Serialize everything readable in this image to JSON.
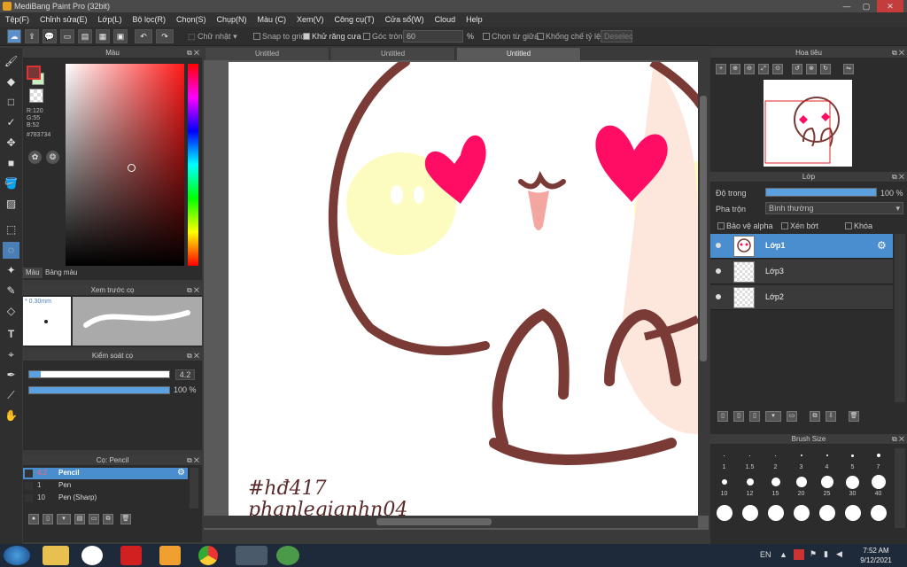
{
  "window": {
    "title": "MediBang Paint Pro (32bit)",
    "minimize": "—",
    "maximize": "▢",
    "close": "✕"
  },
  "menu": [
    "Tệp(F)",
    "Chỉnh sửa(E)",
    "Lớp(L)",
    "Bộ lọc(R)",
    "Chọn(S)",
    "Chụp(N)",
    "Màu (C)",
    "Xem(V)",
    "Công cụ(T)",
    "Cửa sổ(W)",
    "Cloud",
    "Help"
  ],
  "toolbar": {
    "selection_mode": "Chữ nhật",
    "snap_to_grid": "Snap to grid",
    "antialias": "Khử răng cưa",
    "round_corner": "Góc tròn",
    "round_value": "60",
    "percent": "%",
    "select_center": "Chọn từ giữa",
    "fixed_ratio": "Khống chế tỷ lệ",
    "deselect": "Deselec"
  },
  "color_panel": {
    "title": "Màu",
    "r": "R:120",
    "g": "G:55",
    "b": "B:52",
    "hex": "#783734",
    "tab_color": "Màu",
    "tab_palette": "Bảng màu",
    "primary": "#783734",
    "secondary": "#c8f0c0"
  },
  "brush_preview": {
    "title": "Xem trước cọ",
    "size": "0.30mm"
  },
  "brush_control": {
    "title": "Kiểm soát cọ",
    "size_value": "4.2",
    "opacity_value": "100 %",
    "size_fraction": 0.08,
    "opacity_fraction": 1.0
  },
  "brush_list": {
    "title": "Cọ: Pencil",
    "items": [
      {
        "size": "4.2",
        "name": "Pencil"
      },
      {
        "size": "1",
        "name": "Pen"
      },
      {
        "size": "10",
        "name": "Pen (Sharp)"
      }
    ]
  },
  "doc_tabs": [
    "Untitled",
    "Untitled",
    "Untitled"
  ],
  "canvas": {
    "signature_line1": "#hđ417",
    "signature_line2": "phanlegianhn04"
  },
  "navigator": {
    "title": "Hoa tiêu"
  },
  "layers_panel": {
    "title": "Lớp",
    "opacity_label": "Độ trong",
    "opacity_value": "100 %",
    "opacity_fraction": 1.0,
    "blend_label": "Pha trộn",
    "blend_value": "Bình thường",
    "protect_alpha": "Bảo vệ alpha",
    "clipping": "Xén bớt",
    "lock": "Khóa",
    "layers": [
      {
        "name": "Lớp1"
      },
      {
        "name": "Lớp3"
      },
      {
        "name": "Lớp2"
      }
    ]
  },
  "brush_size": {
    "title": "Brush Size",
    "row1": [
      "1",
      "1.5",
      "2",
      "3",
      "4",
      "5",
      "7"
    ],
    "row2": [
      "10",
      "12",
      "15",
      "20",
      "25",
      "30",
      "40"
    ]
  },
  "taskbar": {
    "lang": "EN",
    "time": "7:52 AM",
    "date": "9/12/2021"
  }
}
